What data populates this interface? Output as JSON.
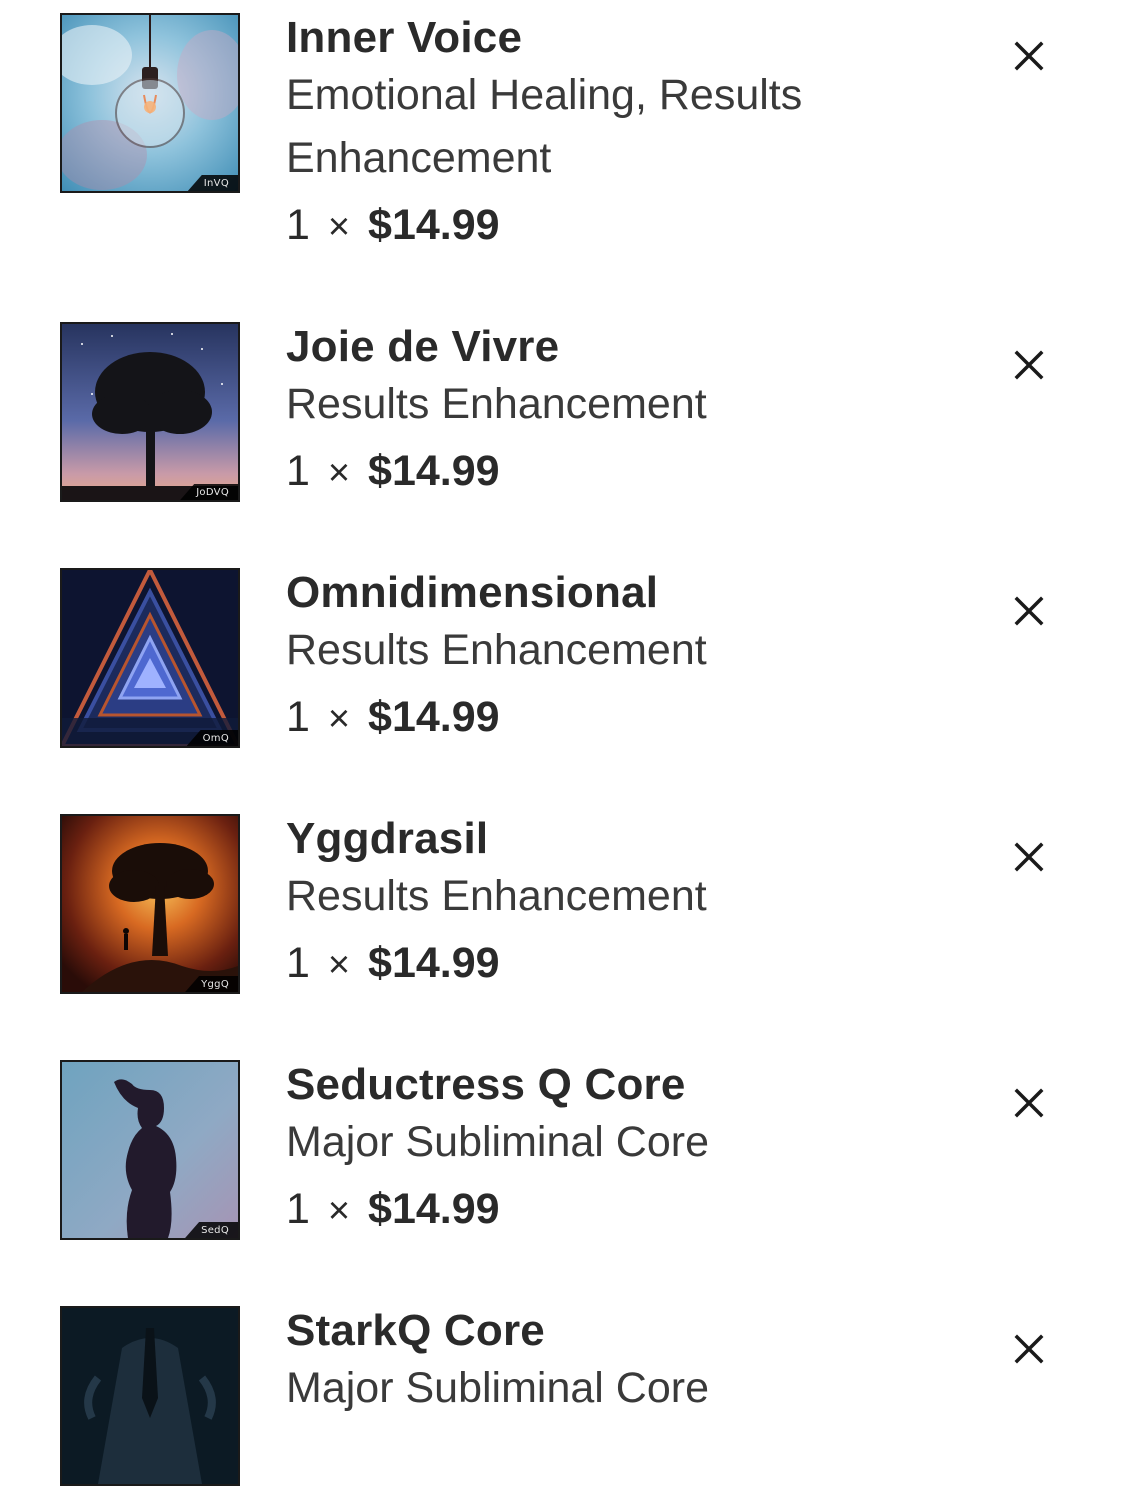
{
  "cart": {
    "items": [
      {
        "title": "Inner Voice",
        "category": "Emotional Healing, Results Enhancement",
        "quantity": "1",
        "times": "×",
        "price": "$14.99",
        "thumb_code": "InVQ",
        "remove_icon": "close-icon"
      },
      {
        "title": "Joie de Vivre",
        "category": "Results Enhancement",
        "quantity": "1",
        "times": "×",
        "price": "$14.99",
        "thumb_code": "JoDVQ",
        "remove_icon": "close-icon"
      },
      {
        "title": "Omnidimensional",
        "category": "Results Enhancement",
        "quantity": "1",
        "times": "×",
        "price": "$14.99",
        "thumb_code": "OmQ",
        "remove_icon": "close-icon"
      },
      {
        "title": "Yggdrasil",
        "category": "Results Enhancement",
        "quantity": "1",
        "times": "×",
        "price": "$14.99",
        "thumb_code": "YggQ",
        "remove_icon": "close-icon"
      },
      {
        "title": "Seductress Q Core",
        "category": "Major Subliminal Core",
        "quantity": "1",
        "times": "×",
        "price": "$14.99",
        "thumb_code": "SedQ",
        "remove_icon": "close-icon"
      },
      {
        "title": "StarkQ Core",
        "category": "Major Subliminal Core",
        "quantity": "",
        "times": "",
        "price": "",
        "thumb_code": "",
        "remove_icon": "close-icon"
      }
    ]
  }
}
